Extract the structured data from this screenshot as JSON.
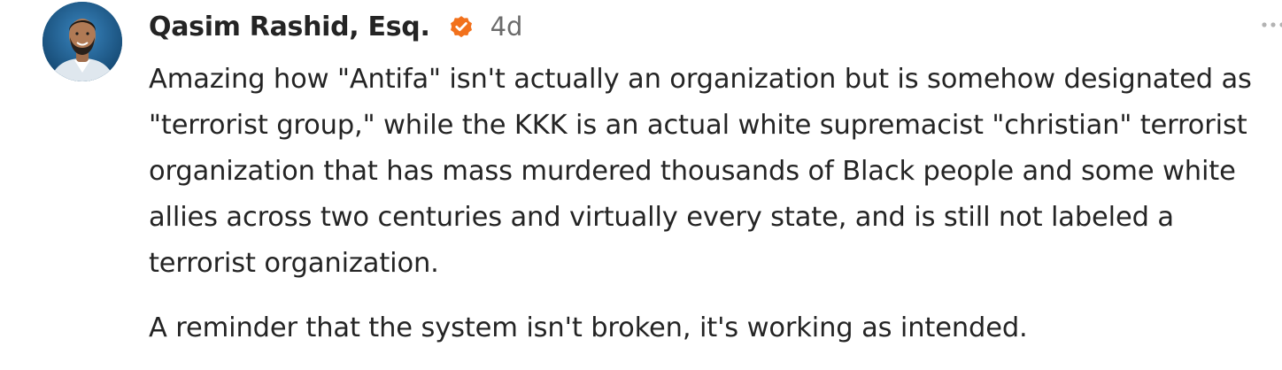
{
  "post": {
    "author": {
      "name": "Qasim Rashid, Esq.",
      "avatar_icon": "author-avatar",
      "verified_icon": "verified-badge-icon",
      "verified_color": "#F2711C"
    },
    "timestamp": "4d",
    "menu_icon": "more-options-icon",
    "paragraphs": [
      "Amazing how \"Antifa\" isn't actually an organization but is somehow designated as \"terrorist group,\" while the KKK is an actual white supremacist \"christian\" terrorist organization that has mass murdered thousands of Black people and some white allies across two centuries and virtually every state, and is still not labeled a terrorist organization.",
      "A reminder that the system isn't broken, it's working as intended."
    ]
  }
}
